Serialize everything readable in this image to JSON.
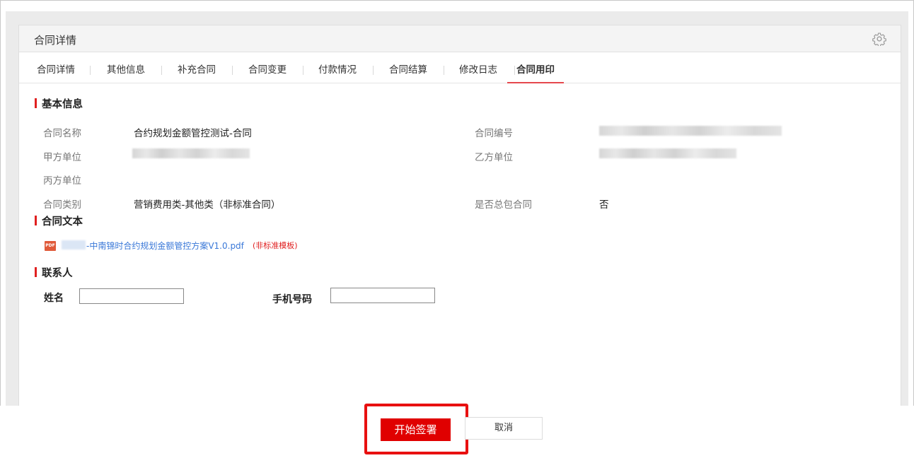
{
  "panel": {
    "title": "合同详情"
  },
  "tabs": [
    {
      "label": "合同详情"
    },
    {
      "label": "其他信息"
    },
    {
      "label": "补充合同"
    },
    {
      "label": "合同变更"
    },
    {
      "label": "付款情况"
    },
    {
      "label": "合同结算"
    },
    {
      "label": "修改日志"
    },
    {
      "label": "合同用印",
      "active": true
    }
  ],
  "basic_info": {
    "section_title": "基本信息",
    "contract_name_label": "合同名称",
    "contract_name_value": "合约规划金额管控测试-合同",
    "contract_no_label": "合同编号",
    "party_a_label": "甲方单位",
    "party_b_label": "乙方单位",
    "party_c_label": "丙方单位",
    "contract_type_label": "合同类别",
    "contract_type_value": "营销费用类-其他类（非标准合同）",
    "is_general_label": "是否总包合同",
    "is_general_value": "否"
  },
  "contract_text": {
    "section_title": "合同文本",
    "pdf_icon_text": "PDF",
    "file_name": "-中南锦时合约规划金额管控方案V1.0.pdf",
    "file_tag": "(非标准模板)"
  },
  "contact": {
    "section_title": "联系人",
    "name_label": "姓名",
    "name_value": "",
    "phone_label": "手机号码",
    "phone_value": ""
  },
  "footer": {
    "start_sign_label": "开始签署",
    "cancel_label": "取消"
  },
  "colors": {
    "accent_red": "#e00000",
    "link_blue": "#3a78d8",
    "section_bar": "#e02020"
  },
  "icons": {
    "settings": "gear-icon",
    "file": "pdf-file-icon"
  }
}
